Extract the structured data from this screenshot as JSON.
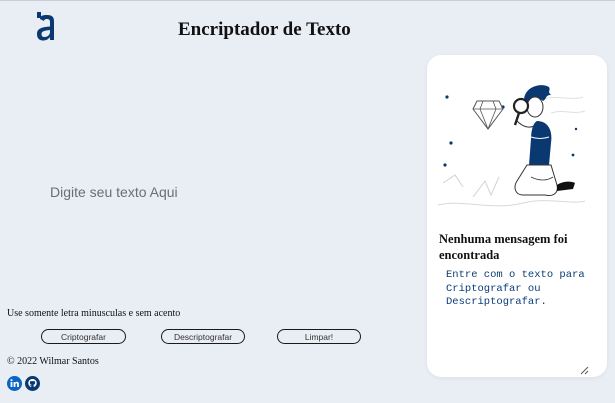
{
  "header": {
    "title": "Encriptador de Texto",
    "logo_icon": "alura-a-logo"
  },
  "main": {
    "input_placeholder": "Digite seu texto Aqui",
    "hint": "Use somente letra minusculas e sem acento",
    "buttons": {
      "encrypt_label": "Criptografar",
      "decrypt_label": "Descriptografar",
      "clear_label": "Limpar!"
    }
  },
  "footer": {
    "copyright": "© 2022 Wilmar Santos",
    "social_icons": [
      "linkedin-icon",
      "github-icon"
    ]
  },
  "output_panel": {
    "illustration": "person-with-magnifier-illustration",
    "title": "Nenhuma mensagem foi encontrada",
    "text": "Entre com o texto para\nCriptografar ou\nDescriptografar."
  },
  "colors": {
    "background": "#e9edf4",
    "brand": "#0a3871",
    "card": "#ffffff"
  }
}
